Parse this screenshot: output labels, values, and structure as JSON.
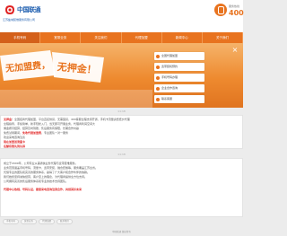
{
  "header": {
    "logo_text": "中国联通",
    "logo_subtitle": "江苏盐城装维服务有限公司",
    "hotline_label": "服务热线",
    "hotline_number": "400"
  },
  "nav": {
    "items": [
      "手机号码",
      "宽带业务",
      "关注我们",
      "代理加盟",
      "新闻中心",
      "关于我们"
    ],
    "active_index": 0
  },
  "banner": {
    "slogan_1": "无加盟费，",
    "slogan_2": "无押金！",
    "cta": "立即加盟",
    "panel_items": [
      "全国代理加盟",
      "宽带装机预约",
      "手机号码办理",
      "企业合作咨询",
      "联系客服"
    ]
  },
  "card1": {
    "time": "11:18",
    "lines": [
      {
        "pre": "",
        "hl": "无押金",
        "post": "！全国招商代理加盟，平台直接供货，无需囤货，400客服全程支持开通，手机卡流量资费低价代理"
      },
      {
        "pre": "全程指导，",
        "hl": "",
        "post": "手续简单，新手轻松入门，当天即可开展业务，代理商利润空间大"
      },
      {
        "pre": "",
        "hl": "",
        "post": "佣金按月结算，结算及时到账，售后服务有保障，长期合作共赢"
      },
      {
        "pre": "免费试用期间，",
        "hl": "免收代理加盟费",
        "post": "，专业团队一对一服务"
      },
      {
        "pre": "",
        "hl": "",
        "post": "欢迎来电咨询洽谈"
      },
      {
        "pre": "",
        "hl": "现在加盟送流量卡",
        "post": ""
      },
      {
        "pre": "",
        "hl": "名额有限先到先得",
        "post": ""
      }
    ]
  },
  "card2": {
    "time": "11:18",
    "lines": [
      {
        "text": "成立于2009年，公司专业从事通信业务代理与宽带装维服务。"
      },
      {
        "text": "业务范围涵盖手机号码、流量卡、宽带安装、融合套餐等，服务覆盖江苏全省。"
      },
      {
        "text": "凭借专业的团队和完善的服务体系，赢得了广大客户和合作伙伴的信赖。"
      },
      {
        "text": "我们始终坚持诚信经营，客户至上的理念，为代理商提供全方位支持。"
      },
      {
        "text": "公司拥有完善的售后服务体系和专业的技术支持团队。"
      }
    ],
    "highlight": "代理中心热线，号码认证，愿您来电咨询洽谈合作，共创美好未来"
  },
  "footer": {
    "tabs": [
      "手机号码",
      "宽带业务",
      "代理加盟",
      "联系我们"
    ],
    "copyright": "中国联通 版权所有"
  }
}
